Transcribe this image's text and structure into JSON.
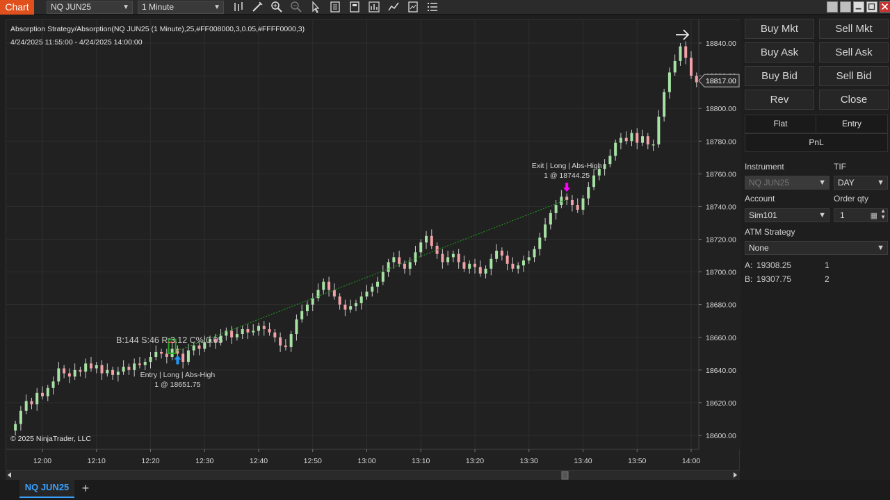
{
  "toolbar": {
    "chart_label": "Chart",
    "instrument": "NQ JUN25",
    "interval": "1 Minute",
    "icons": [
      "bar-type-icon",
      "draw-tools-icon",
      "zoom-in-icon",
      "zoom-out-icon",
      "cursor-icon",
      "data-box-icon",
      "properties-icon",
      "strategies-icon",
      "indicators-icon",
      "templates-icon",
      "menu-icon"
    ]
  },
  "chart": {
    "title_line": "Absorption Strategy/Absorption(NQ JUN25 (1 Minute),25,#FF008000,3,0.05,#FFFF0000,3)",
    "range_line": "4/24/2025 11:55:00 - 4/24/2025 14:00:00",
    "copyright": "© 2025 NinjaTrader, LLC",
    "current_price": "18817.00",
    "y_labels": [
      "18840.00",
      "18820.00",
      "18800.00",
      "18780.00",
      "18760.00",
      "18740.00",
      "18720.00",
      "18700.00",
      "18680.00",
      "18660.00",
      "18640.00",
      "18620.00",
      "18600.00"
    ],
    "x_labels": [
      "12:00",
      "12:10",
      "12:20",
      "12:30",
      "12:40",
      "12:50",
      "13:00",
      "13:10",
      "13:20",
      "13:30",
      "13:40",
      "13:50",
      "14:00"
    ],
    "signal_text": "B:144 S:46 R:3.12 C%:0.05",
    "entry_label_1": "Entry | Long | Abs-High",
    "entry_label_2": "1 @ 18651.75",
    "exit_label_1": "Exit | Long | Abs-High",
    "exit_label_2": "1 @ 18744.25",
    "colors": {
      "up": "#a6e2a4",
      "down": "#f2a1a7",
      "entry_arrow": "#2196f3",
      "exit_arrow": "#ff00ff",
      "trade_line": "#1f8f1f"
    }
  },
  "chart_data": {
    "type": "candlestick",
    "x_axis": [
      "11:55",
      "14:00"
    ],
    "ylim": [
      18600,
      18840
    ],
    "closes": [
      18607,
      18615,
      18621,
      18619,
      18626,
      18624,
      18629,
      18633,
      18641,
      18638,
      18636,
      18640,
      18639,
      18644,
      18641,
      18643,
      18638,
      18640,
      18637,
      18639,
      18642,
      18640,
      18644,
      18643,
      18645,
      18648,
      18651,
      18650,
      18648,
      18653,
      18650,
      18645,
      18652,
      18655,
      18653,
      18657,
      18659,
      18657,
      18661,
      18664,
      18660,
      18662,
      18665,
      18663,
      18664,
      18667,
      18665,
      18663,
      18660,
      18655,
      18654,
      18662,
      18671,
      18676,
      18680,
      18684,
      18689,
      18694,
      18689,
      18685,
      18680,
      18677,
      18679,
      18681,
      18685,
      18688,
      18691,
      18694,
      18700,
      18706,
      18709,
      18705,
      18702,
      18706,
      18712,
      18718,
      18722,
      18716,
      18711,
      18706,
      18709,
      18711,
      18706,
      18702,
      18705,
      18703,
      18699,
      18702,
      18708,
      18713,
      18710,
      18705,
      18702,
      18704,
      18707,
      18709,
      18714,
      18721,
      18729,
      18736,
      18741,
      18746,
      18744,
      18741,
      18738,
      18745,
      18752,
      18759,
      18763,
      18766,
      18771,
      18779,
      18782,
      18780,
      18785,
      18779,
      18783,
      18778,
      18778,
      18795,
      18810,
      18822,
      18829,
      18838,
      18831,
      18820,
      18816
    ]
  },
  "order_panel": {
    "buttons": [
      [
        "Buy Mkt",
        "Sell Mkt"
      ],
      [
        "Buy Ask",
        "Sell Ask"
      ],
      [
        "Buy Bid",
        "Sell Bid"
      ],
      [
        "Rev",
        "Close"
      ]
    ],
    "position": {
      "flat": "Flat",
      "entry": "Entry",
      "pnl": "PnL"
    },
    "instrument_label": "Instrument",
    "instrument_value": "NQ JUN25",
    "tif_label": "TIF",
    "tif_value": "DAY",
    "account_label": "Account",
    "account_value": "Sim101",
    "qty_label": "Order qty",
    "qty_value": "1",
    "atm_label": "ATM Strategy",
    "atm_value": "None",
    "ask_prefix": "A:",
    "ask_price": "19308.25",
    "ask_size": "1",
    "bid_prefix": "B:",
    "bid_price": "19307.75",
    "bid_size": "2"
  },
  "tabs": {
    "active": "NQ JUN25",
    "add": "+"
  }
}
